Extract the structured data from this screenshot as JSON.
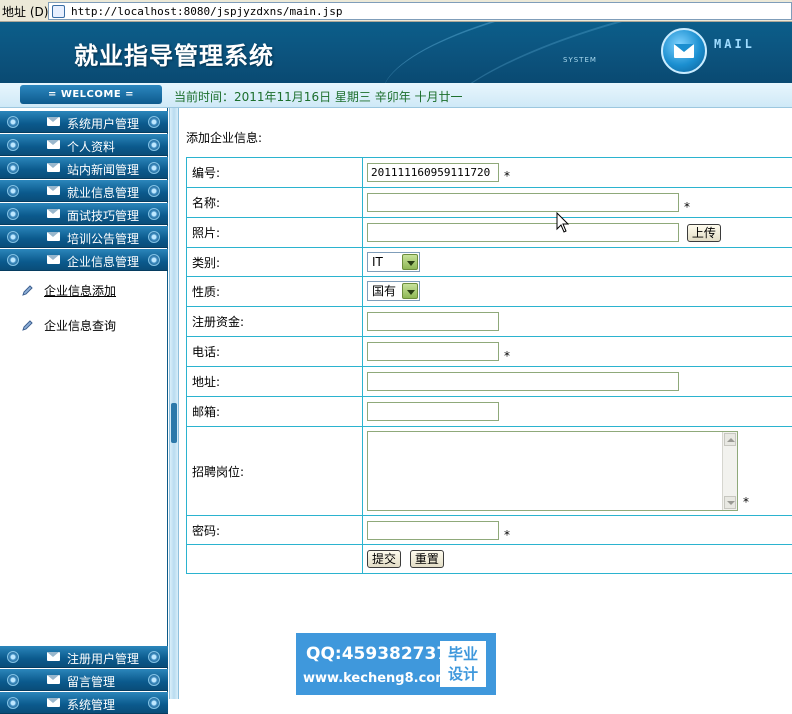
{
  "browser": {
    "address_label": "地址 (D)",
    "url": "http://localhost:8080/jspjyzdxns/main.jsp"
  },
  "header": {
    "title": "就业指导管理系统",
    "system_text": "SYSTEM",
    "mail_text": "MAIL"
  },
  "welcome_bar": {
    "welcome_label": "= WELCOME =",
    "current_time": "当前时间：2011年11月16日 星期三 辛卯年 十月廿一"
  },
  "sidebar": {
    "top_menu": [
      {
        "label": "系统用户管理"
      },
      {
        "label": "个人资料"
      },
      {
        "label": "站内新闻管理"
      },
      {
        "label": "就业信息管理"
      },
      {
        "label": "面试技巧管理"
      },
      {
        "label": "培训公告管理"
      },
      {
        "label": "企业信息管理"
      }
    ],
    "sub_items": [
      {
        "label": "企业信息添加"
      },
      {
        "label": "企业信息查询"
      }
    ],
    "bottom_menu": [
      {
        "label": "注册用户管理"
      },
      {
        "label": "留言管理"
      },
      {
        "label": "系统管理"
      }
    ]
  },
  "form": {
    "title": "添加企业信息:",
    "required_mark": "*",
    "fields": {
      "id": {
        "label": "编号:",
        "value": "2011111609591117​20"
      },
      "name": {
        "label": "名称:",
        "value": ""
      },
      "photo": {
        "label": "照片:",
        "value": "",
        "upload_button": "上传"
      },
      "category": {
        "label": "类别:",
        "selected": "IT"
      },
      "nature": {
        "label": "性质:",
        "selected": "国有"
      },
      "capital": {
        "label": "注册资金:",
        "value": ""
      },
      "phone": {
        "label": "电话:",
        "value": ""
      },
      "address": {
        "label": "地址:",
        "value": ""
      },
      "email": {
        "label": "邮箱:",
        "value": ""
      },
      "positions": {
        "label": "招聘岗位:",
        "value": ""
      },
      "password": {
        "label": "密码:",
        "value": ""
      }
    },
    "submit_button": "提交",
    "reset_button": "重置"
  },
  "watermark": {
    "qq": "QQ:459382737",
    "site": "www.kecheng8.com",
    "badge_line1": "毕业",
    "badge_line2": "设计"
  }
}
